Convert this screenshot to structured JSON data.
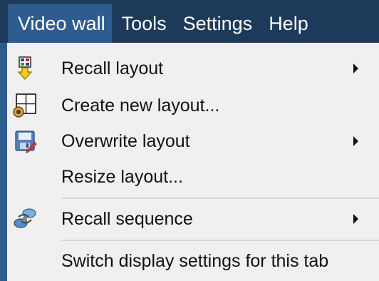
{
  "menubar": {
    "items": [
      {
        "label": "Video wall"
      },
      {
        "label": "Tools"
      },
      {
        "label": "Settings"
      },
      {
        "label": "Help"
      }
    ]
  },
  "dropdown": {
    "items": [
      {
        "label": "Recall layout",
        "icon": "recall-layout-icon",
        "has_submenu": true
      },
      {
        "label": "Create new layout...",
        "icon": "create-layout-icon",
        "has_submenu": false
      },
      {
        "label": "Overwrite layout",
        "icon": "overwrite-layout-icon",
        "has_submenu": true
      },
      {
        "label": "Resize layout...",
        "icon": "",
        "has_submenu": false
      },
      {
        "label": "Recall sequence",
        "icon": "recall-sequence-icon",
        "has_submenu": true
      },
      {
        "label": "Switch display settings for this tab",
        "icon": "",
        "has_submenu": false
      }
    ]
  },
  "colors": {
    "menubar_bg": "#1d3a5a",
    "active_menu_bg": "#2f5c8e",
    "dropdown_bg": "#f0f0f0",
    "separator": "#d7d7d7"
  }
}
